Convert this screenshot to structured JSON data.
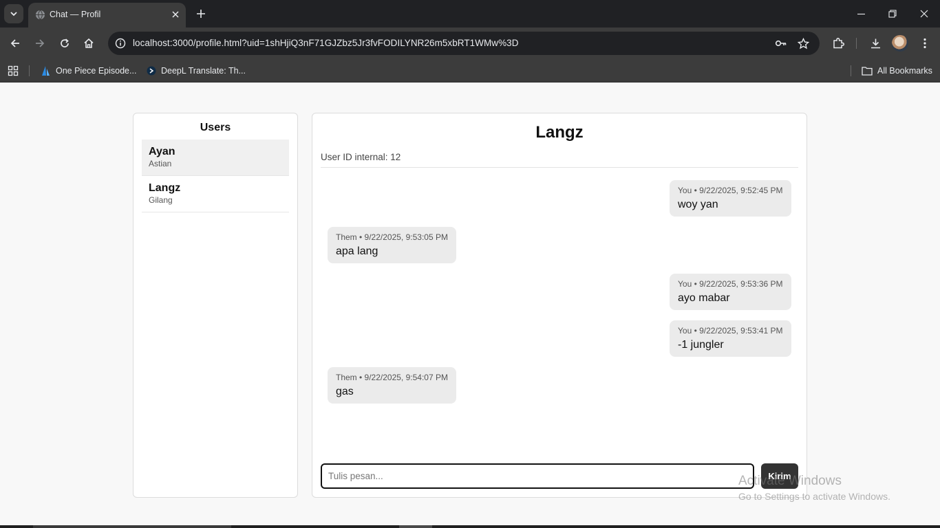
{
  "browser": {
    "tab_title": "Chat — Profil",
    "url": "localhost:3000/profile.html?uid=1shHjiQ3nF71GJZbz5Jr3fvFODILYNR26m5xbRT1WMw%3D",
    "bookmarks": [
      {
        "label": "One Piece Episode...",
        "icon": "one-piece-favicon"
      },
      {
        "label": "DeepL Translate: Th...",
        "icon": "deepl-favicon"
      }
    ],
    "all_bookmarks_label": "All Bookmarks"
  },
  "users": {
    "title": "Users",
    "list": [
      {
        "name": "Ayan",
        "sub": "Astian",
        "active": true
      },
      {
        "name": "Langz",
        "sub": "Gilang",
        "active": false
      }
    ]
  },
  "chat": {
    "title": "Langz",
    "meta": "User ID internal: 12",
    "messages": [
      {
        "meta": "You • 9/22/2025, 9:52:45 PM",
        "text": "woy yan",
        "from": "me"
      },
      {
        "meta": "Them • 9/22/2025, 9:53:05 PM",
        "text": "apa lang",
        "from": "them"
      },
      {
        "meta": "You • 9/22/2025, 9:53:36 PM",
        "text": "ayo mabar",
        "from": "me"
      },
      {
        "meta": "You • 9/22/2025, 9:53:41 PM",
        "text": "-1 jungler",
        "from": "me"
      },
      {
        "meta": "Them • 9/22/2025, 9:54:07 PM",
        "text": "gas",
        "from": "them"
      }
    ],
    "input_placeholder": "Tulis pesan...",
    "input_value": "",
    "send_label": "Kirim"
  },
  "watermark": {
    "title": "Activate Windows",
    "subtitle": "Go to Settings to activate Windows."
  },
  "colors": {
    "chrome_dark": "#202124",
    "chrome_toolbar": "#3c3c3c",
    "page_bg": "#f8f8f8",
    "bubble": "#ebebeb",
    "send_button": "#333333"
  }
}
